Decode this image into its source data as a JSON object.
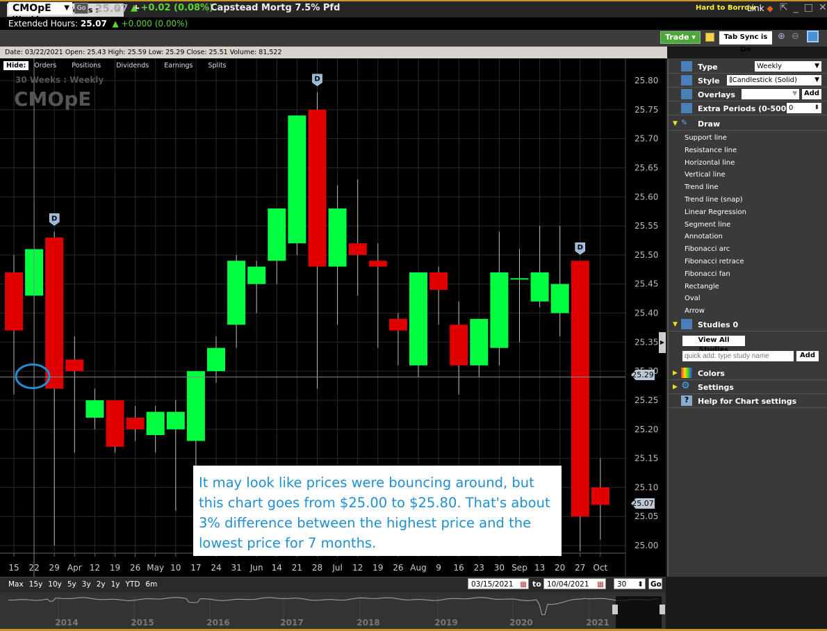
{
  "header": {
    "symbol": "CMOpE",
    "go": "Go",
    "last": "25.07",
    "change": "+0.02 (0.08%)",
    "name": "Capstead Mortg  7.5% Pfd",
    "hard_to_borrow": "Hard to Borrow",
    "link": "Link"
  },
  "extended": {
    "label": "Extended Hours:",
    "price": "25.07",
    "change": "+0.000 (0.00%)"
  },
  "tab": {
    "label": "CMOpE : 30  Weeks : Weekly",
    "add": "+"
  },
  "toolbar": {
    "trade": "Trade ▾",
    "tab_sync": "Tab Sync is On"
  },
  "info_line": "Date: 03/22/2021   Open: 25.43   High: 25.59   Low: 25.29   Close: 25.51   Volume: 81,522",
  "hide_row": {
    "hide": "Hide:",
    "items": [
      "Orders",
      "Positions",
      "Dividends",
      "Earnings",
      "Splits"
    ]
  },
  "watermark": {
    "period": "30  Weeks : Weekly",
    "symbol": "CMOpE"
  },
  "price_tags": {
    "crosshair": "25.29",
    "last": "25.07"
  },
  "dividend_marker": "D",
  "annotation": "It may look like prices were bouncing around, but this chart goes from $25.00 to $25.80. That's about 3% difference between the highest price and the lowest price for 7 months.",
  "panel": {
    "type_label": "Type",
    "type_value": "Weekly",
    "style_label": "Style",
    "style_value": "Candlestick (Solid)",
    "overlays_label": "Overlays",
    "add": "Add",
    "extra_label": "Extra Periods (0-500)",
    "extra_value": "0",
    "draw_label": "Draw",
    "draw_items": [
      "Support line",
      "Resistance line",
      "Horizontal line",
      "Vertical line",
      "Trend line",
      "Trend line (snap)",
      "Linear Regression",
      "Segment line",
      "Annotation",
      "Fibonacci arc",
      "Fibonacci retrace",
      "Fibonacci fan",
      "Rectangle",
      "Oval",
      "Arrow"
    ],
    "studies_label": "Studies 0",
    "view_all": "View All Studies",
    "quick_add_placeholder": "quick add: type study name",
    "colors": "Colors",
    "settings": "Settings",
    "help": "Help for Chart settings"
  },
  "range_bar": {
    "ranges": [
      "Max",
      "15y",
      "10y",
      "5y",
      "3y",
      "2y",
      "1y",
      "YTD",
      "6m"
    ],
    "from": "03/15/2021",
    "to_label": "to",
    "to": "10/04/2021",
    "periods": "30",
    "go": "Go"
  },
  "navigator_years": [
    "2014",
    "2015",
    "2016",
    "2017",
    "2018",
    "2019",
    "2020",
    "2021"
  ],
  "colors": {
    "up": "#00ff40",
    "down": "#e00000",
    "accent": "#4ea63a"
  },
  "chart_data": {
    "type": "candlestick",
    "ylim": [
      25.0,
      25.8
    ],
    "yticks": [
      "25.80",
      "25.75",
      "25.70",
      "25.65",
      "25.60",
      "25.55",
      "25.50",
      "25.45",
      "25.40",
      "25.35",
      "25.30",
      "25.25",
      "25.20",
      "25.15",
      "25.10",
      "25.05",
      "25.00"
    ],
    "xticks": [
      "15",
      "22",
      "29",
      "Apr",
      "12",
      "19",
      "26",
      "May",
      "10",
      "17",
      "24",
      "31",
      "Jun",
      "14",
      "21",
      "28",
      "Jul",
      "12",
      "19",
      "26",
      "Aug",
      "9",
      "16",
      "23",
      "30",
      "Sep",
      "13",
      "20",
      "27",
      "Oct"
    ],
    "candles": [
      {
        "o": 25.47,
        "c": 25.37,
        "h": 25.5,
        "l": 25.26
      },
      {
        "o": 25.43,
        "c": 25.51,
        "h": 25.59,
        "l": 25.29
      },
      {
        "o": 25.53,
        "c": 25.27,
        "h": 25.54,
        "l": 25.0
      },
      {
        "o": 25.32,
        "c": 25.3,
        "h": 25.36,
        "l": 25.16
      },
      {
        "o": 25.22,
        "c": 25.25,
        "h": 25.27,
        "l": 25.2
      },
      {
        "o": 25.25,
        "c": 25.17,
        "h": 25.25,
        "l": 25.16
      },
      {
        "o": 25.22,
        "c": 25.2,
        "h": 25.24,
        "l": 25.18
      },
      {
        "o": 25.19,
        "c": 25.23,
        "h": 25.24,
        "l": 25.16
      },
      {
        "o": 25.2,
        "c": 25.23,
        "h": 25.25,
        "l": 25.06
      },
      {
        "o": 25.18,
        "c": 25.3,
        "h": 25.3,
        "l": 25.05
      },
      {
        "o": 25.3,
        "c": 25.34,
        "h": 25.36,
        "l": 25.28
      },
      {
        "o": 25.38,
        "c": 25.49,
        "h": 25.5,
        "l": 25.34
      },
      {
        "o": 25.45,
        "c": 25.48,
        "h": 25.49,
        "l": 25.4
      },
      {
        "o": 25.49,
        "c": 25.58,
        "h": 25.58,
        "l": 25.45
      },
      {
        "o": 25.52,
        "c": 25.74,
        "h": 25.74,
        "l": 25.5
      },
      {
        "o": 25.75,
        "c": 25.48,
        "h": 25.78,
        "l": 25.27
      },
      {
        "o": 25.48,
        "c": 25.58,
        "h": 25.62,
        "l": 25.38
      },
      {
        "o": 25.52,
        "c": 25.5,
        "h": 25.63,
        "l": 25.43
      },
      {
        "o": 25.49,
        "c": 25.48,
        "h": 25.52,
        "l": 25.34
      },
      {
        "o": 25.39,
        "c": 25.37,
        "h": 25.4,
        "l": 25.31
      },
      {
        "o": 25.31,
        "c": 25.47,
        "h": 25.47,
        "l": 25.29
      },
      {
        "o": 25.47,
        "c": 25.44,
        "h": 25.48,
        "l": 25.38
      },
      {
        "o": 25.38,
        "c": 25.31,
        "h": 25.42,
        "l": 25.26
      },
      {
        "o": 25.31,
        "c": 25.39,
        "h": 25.39,
        "l": 25.29
      },
      {
        "o": 25.34,
        "c": 25.47,
        "h": 25.54,
        "l": 25.31
      },
      {
        "o": 25.46,
        "c": 25.46,
        "h": 25.51,
        "l": 25.35
      },
      {
        "o": 25.42,
        "c": 25.47,
        "h": 25.55,
        "l": 25.41
      },
      {
        "o": 25.4,
        "c": 25.45,
        "h": 25.55,
        "l": 25.36
      },
      {
        "o": 25.49,
        "c": 25.05,
        "h": 25.49,
        "l": 24.99
      },
      {
        "o": 25.1,
        "c": 25.07,
        "h": 25.15,
        "l": 25.01
      }
    ],
    "dividends_at": [
      2,
      15,
      28
    ]
  }
}
